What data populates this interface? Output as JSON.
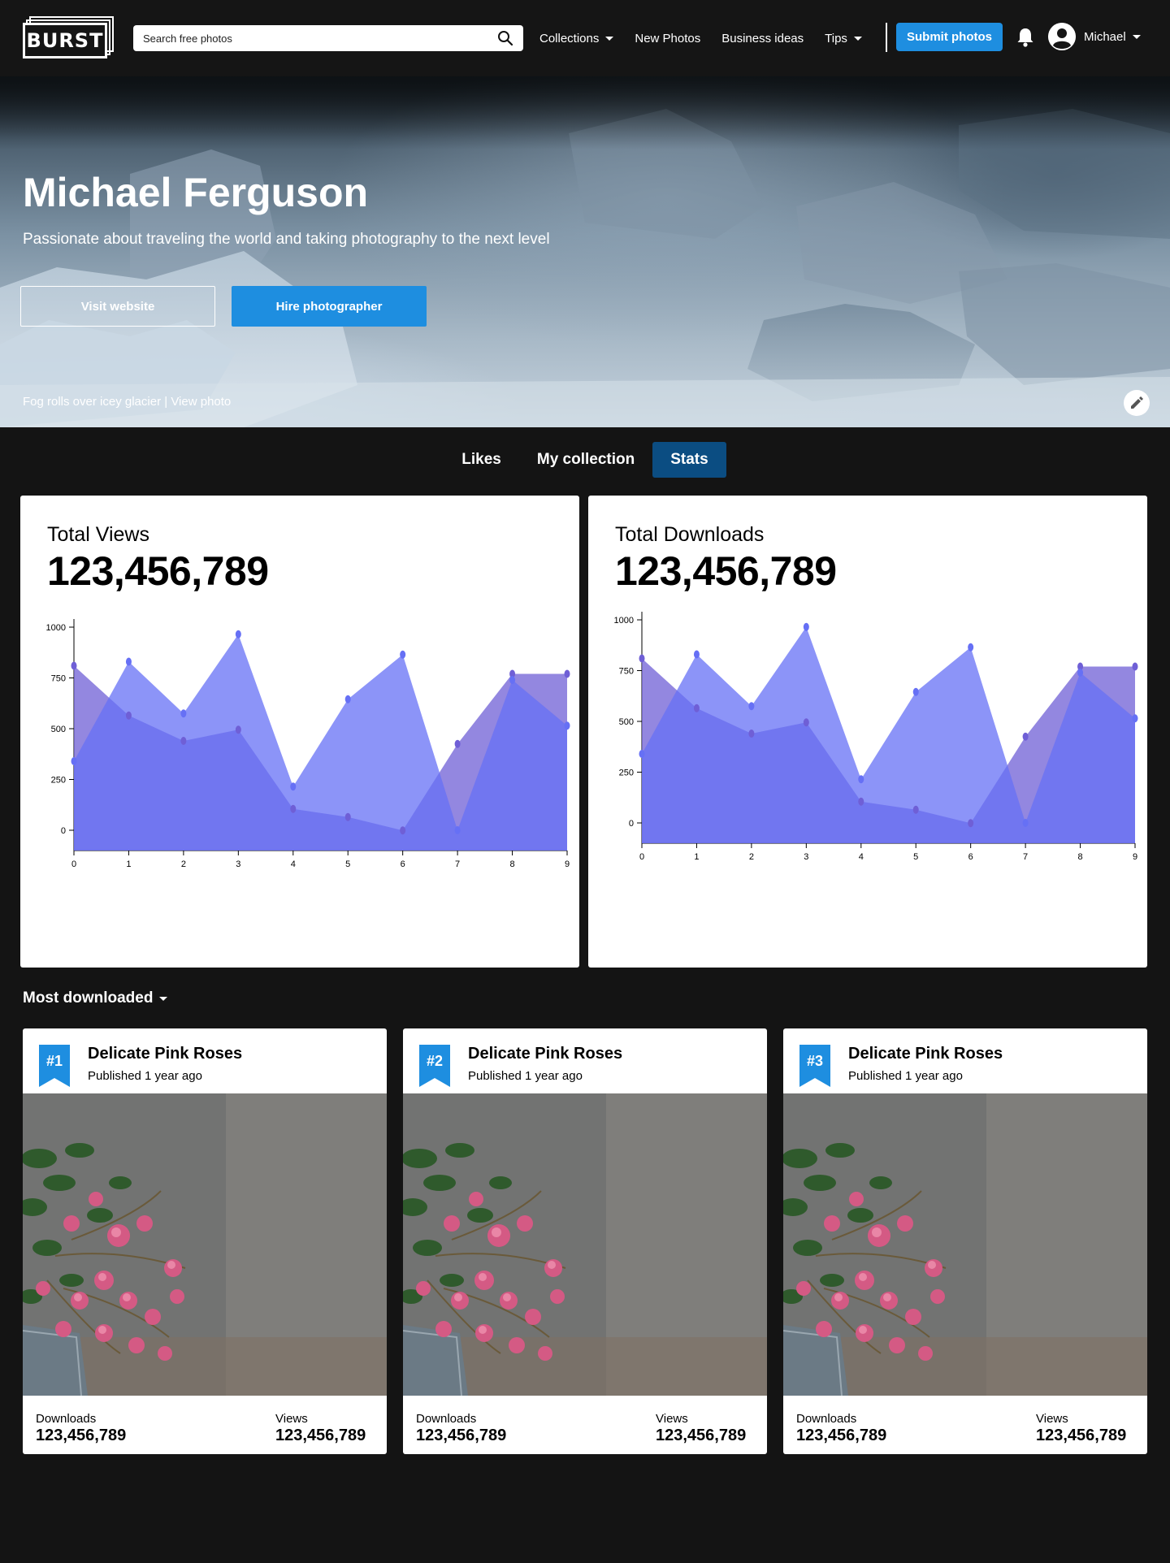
{
  "nav": {
    "logo": "BURST",
    "search_placeholder": "Search free photos",
    "links": [
      {
        "label": "Collections",
        "dropdown": true
      },
      {
        "label": "New Photos",
        "dropdown": false
      },
      {
        "label": "Business ideas",
        "dropdown": false
      },
      {
        "label": "Tips",
        "dropdown": true
      }
    ],
    "submit_label": "Submit photos",
    "user_name": "Michael"
  },
  "hero": {
    "name": "Michael Ferguson",
    "bio": "Passionate about traveling the world and taking photography to the next level",
    "visit_label": "Visit website",
    "hire_label": "Hire photographer",
    "caption": "Fog rolls over icey glacier",
    "caption_sep": "|",
    "caption_link": "View photo"
  },
  "tabs": [
    {
      "label": "Likes",
      "active": false
    },
    {
      "label": "My collection",
      "active": false
    },
    {
      "label": "Stats",
      "active": true
    }
  ],
  "stats": [
    {
      "label": "Total Views",
      "value": "123,456,789"
    },
    {
      "label": "Total Downloads",
      "value": "123,456,789"
    }
  ],
  "chart_data": [
    {
      "type": "area",
      "x": [
        0,
        1,
        2,
        3,
        4,
        5,
        6,
        7,
        8,
        9
      ],
      "ylim": [
        0,
        1000
      ],
      "yticks": [
        0,
        250,
        500,
        750,
        1000
      ],
      "series": [
        {
          "values": [
            810,
            565,
            440,
            495,
            105,
            65,
            -1,
            425,
            770,
            770
          ],
          "color": "#6f5fd6"
        },
        {
          "values": [
            340,
            830,
            575,
            965,
            215,
            645,
            865,
            0,
            740,
            515
          ],
          "color": "#6670f5"
        }
      ]
    },
    {
      "type": "area",
      "x": [
        0,
        1,
        2,
        3,
        4,
        5,
        6,
        7,
        8,
        9
      ],
      "ylim": [
        0,
        1000
      ],
      "yticks": [
        0,
        250,
        500,
        750,
        1000
      ],
      "series": [
        {
          "values": [
            810,
            565,
            440,
            495,
            105,
            65,
            -1,
            425,
            770,
            770
          ],
          "color": "#6f5fd6"
        },
        {
          "values": [
            340,
            830,
            575,
            965,
            215,
            645,
            865,
            0,
            740,
            515
          ],
          "color": "#6670f5"
        }
      ]
    }
  ],
  "most_downloaded": {
    "heading": "Most downloaded",
    "items": [
      {
        "rank": "#1",
        "title": "Delicate Pink Roses",
        "published": "Published 1 year ago",
        "downloads_label": "Downloads",
        "downloads": "123,456,789",
        "views_label": "Views",
        "views": "123,456,789"
      },
      {
        "rank": "#2",
        "title": "Delicate Pink Roses",
        "published": "Published 1 year ago",
        "downloads_label": "Downloads",
        "downloads": "123,456,789",
        "views_label": "Views",
        "views": "123,456,789"
      },
      {
        "rank": "#3",
        "title": "Delicate Pink Roses",
        "published": "Published 1 year ago",
        "downloads_label": "Downloads",
        "downloads": "123,456,789",
        "views_label": "Views",
        "views": "123,456,789"
      }
    ]
  },
  "colors": {
    "accent": "#1e8ee0",
    "tab_active": "#0b4d82",
    "background": "#141414"
  }
}
